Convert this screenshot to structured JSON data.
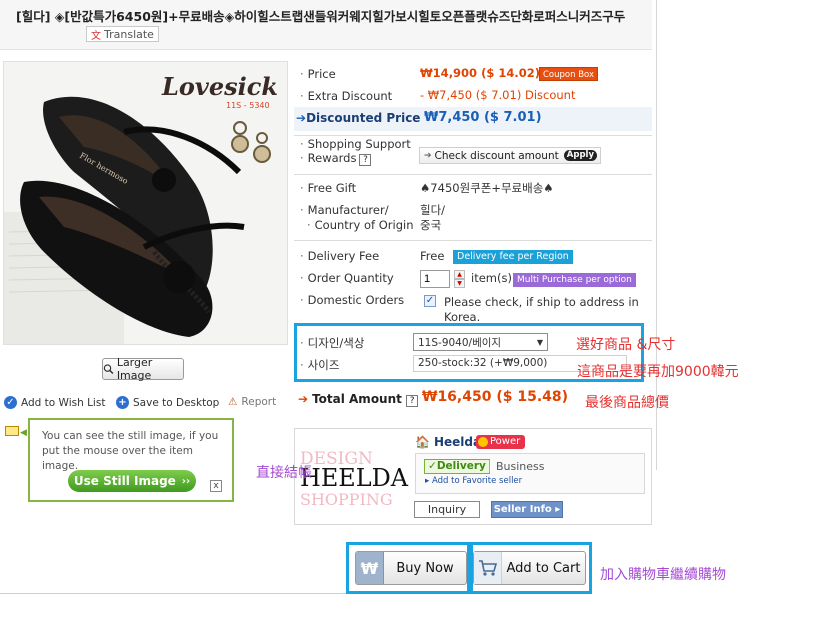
{
  "header": {
    "title": "[힐다] ◈[반값특가6450원]+무료배송◈하이힐스트랩샌들워커웨지힐가보시힐토오픈플랫슈즈단화로퍼스니커즈구두",
    "translate_label": "Translate"
  },
  "image": {
    "brand_script": "Lovesick",
    "code": "11S - 5340",
    "insole_text": "Flor hermoso",
    "larger_image_label": "Larger Image"
  },
  "actions": {
    "wish_list": "Add to Wish List",
    "save_desktop": "Save to Desktop",
    "report": "Report"
  },
  "still_image": {
    "message": "You can see the still image, if you put the mouse over the item image.",
    "button": "Use Still Image",
    "close": "x"
  },
  "info": {
    "price_label": "Price",
    "price_value": "₩14,900 ($ 14.02)",
    "coupon_box": "Coupon Box",
    "extra_discount_label": "Extra Discount",
    "extra_discount_value": "- ₩7,450 ($ 7.01) Discount",
    "discounted_price_label": "Discounted Price",
    "discounted_price_value": "₩7,450 ($ 7.01)",
    "shopping_support_label": "Shopping Support",
    "rewards_label": "Rewards",
    "check_discount": "Check discount amount",
    "apply": "Apply",
    "free_gift_label": "Free Gift",
    "free_gift_value": "♠7450원쿠폰+무료배송♠",
    "manufacturer_label": "Manufacturer/",
    "origin_label": "Country of Origin",
    "manufacturer_value": "힐다/",
    "origin_value": "중국",
    "delivery_fee_label": "Delivery Fee",
    "delivery_fee_value": "Free",
    "delivery_badge": "Delivery fee per Region",
    "order_quantity_label": "Order Quantity",
    "quantity_value": "1",
    "item_unit": "item(s)",
    "multi_purchase": "Multi Purchase per option",
    "domestic_orders_label": "Domestic Orders",
    "ship_check_text": "Please check, if ship to address in Korea.",
    "design_color_label": "디자인/색상",
    "design_color_value": "11S-9040/베이지",
    "size_label": "사이즈",
    "size_value": "250-stock:32 (+₩9,000)",
    "total_label": "Total Amount",
    "total_value": "₩16,450 ($ 15.48)"
  },
  "annotations": {
    "select_note": "選好商品 &尺寸",
    "extra_note": "這商品是要再加9000韓元",
    "total_note": "最後商品總價",
    "direct_note": "直接結帳",
    "cart_note": "加入購物車繼續購物"
  },
  "seller": {
    "logo_bg_top": "DESIGN",
    "logo_main": "HEELDA",
    "logo_bg_bottom": "SHOPPING",
    "name": "Heelda",
    "power": "Power",
    "delivery_tag": "Delivery",
    "business": "Business",
    "add_favorite": "Add to Favorite seller",
    "inquiry": "Inquiry",
    "seller_info": "Seller Info"
  },
  "buttons": {
    "buy_now": "Buy Now",
    "add_to_cart": "Add to Cart"
  },
  "colors": {
    "accent_price": "#e04400",
    "highlight_frame": "#19a3e0",
    "note_red": "#e53030",
    "note_purple": "#a64bd6"
  }
}
